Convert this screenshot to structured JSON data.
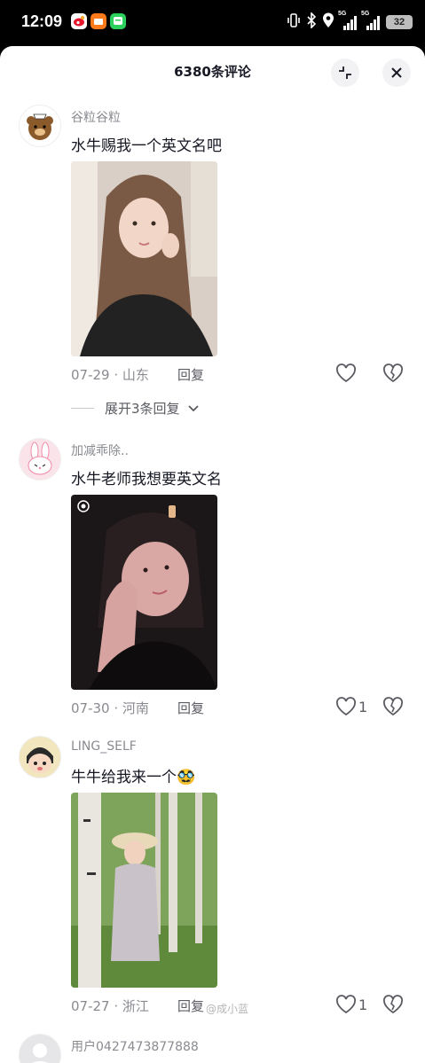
{
  "status_bar": {
    "time": "12:09",
    "network_1": "5G",
    "network_2": "5G",
    "battery": "32"
  },
  "sheet": {
    "title": "6380条评论"
  },
  "comments": [
    {
      "username": "谷粒谷粒",
      "text": "水牛赐我一个英文名吧",
      "date": "07-29",
      "location": "山东",
      "reply_label": "回复",
      "like_count": "",
      "expand_label": "展开3条回复"
    },
    {
      "username": "加减乖除..",
      "text": "水牛老师我想要英文名",
      "date": "07-30",
      "location": "河南",
      "reply_label": "回复",
      "like_count": "1"
    },
    {
      "username": "LING_SELF",
      "text": "牛牛给我来一个🥸",
      "date": "07-27",
      "location": "浙江",
      "reply_label": "回复",
      "like_count": "1"
    },
    {
      "username": "用户0427473877888"
    }
  ],
  "meta_separator": " · ",
  "watermark": "@成小蓝"
}
